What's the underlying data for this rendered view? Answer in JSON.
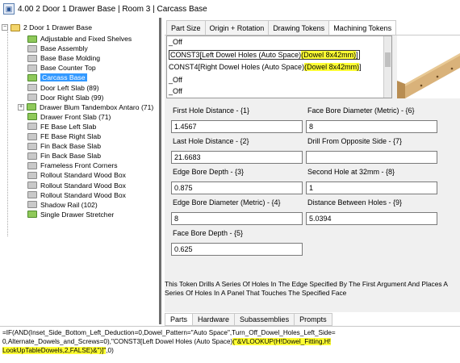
{
  "window": {
    "title": "4.00 2 Door 1 Drawer Base | Room 3 | Carcass Base"
  },
  "tree": {
    "root": "2 Door 1 Drawer Base",
    "items": [
      {
        "label": "Adjustable and Fixed Shelves",
        "color": "green",
        "expand": false
      },
      {
        "label": "Base Assembly",
        "color": "gray",
        "expand": false
      },
      {
        "label": "Base Base Molding",
        "color": "gray",
        "expand": false
      },
      {
        "label": "Base Counter Top",
        "color": "gray",
        "expand": false
      },
      {
        "label": "Carcass Base",
        "color": "green",
        "expand": false,
        "selected": true
      },
      {
        "label": "Door Left Slab (89)",
        "color": "gray",
        "expand": false
      },
      {
        "label": "Door Right Slab (99)",
        "color": "gray",
        "expand": false
      },
      {
        "label": "Drawer Blum Tandembox Antaro (71)",
        "color": "green",
        "expand": true
      },
      {
        "label": "Drawer Front Slab (71)",
        "color": "green",
        "expand": false
      },
      {
        "label": "FE Base Left Slab",
        "color": "gray",
        "expand": false
      },
      {
        "label": "FE Base Right Slab",
        "color": "gray",
        "expand": false
      },
      {
        "label": "Fin Back Base Slab",
        "color": "gray",
        "expand": false
      },
      {
        "label": "Fin Back Base Slab",
        "color": "gray",
        "expand": false
      },
      {
        "label": "Frameless Front Corners",
        "color": "gray",
        "expand": false
      },
      {
        "label": "Rollout Standard Wood Box",
        "color": "gray",
        "expand": false
      },
      {
        "label": "Rollout Standard Wood Box",
        "color": "gray",
        "expand": false
      },
      {
        "label": "Rollout Standard Wood Box",
        "color": "gray",
        "expand": false
      },
      {
        "label": "Shadow Rail (102)",
        "color": "gray",
        "expand": false
      },
      {
        "label": "Single Drawer Stretcher",
        "color": "green",
        "expand": false
      }
    ]
  },
  "tabs": [
    "Part Size",
    "Origin + Rotation",
    "Drawing Tokens",
    "Machining Tokens"
  ],
  "active_tab": "Machining Tokens",
  "tokens": {
    "t0": "_Off",
    "t1_pre": "CONST3[Left Dowel Holes (Auto Space)",
    "t1_hl": "(Dowel 8x42mm)",
    "t1_post": "]",
    "t2_pre": "CONST4[Right Dowel Holes (Auto Space)",
    "t2_hl": "(Dowel 8x42mm)",
    "t2_post": "]",
    "t3": "_Off",
    "t4": "_Off"
  },
  "fields": {
    "f1": {
      "label": "First Hole Distance - {1}",
      "value": "1.4567"
    },
    "f2": {
      "label": "Last Hole Distance - {2}",
      "value": "21.6683"
    },
    "f3": {
      "label": "Edge Bore Depth - {3}",
      "value": "0.875"
    },
    "f4": {
      "label": "Edge Bore Diameter (Metric) - {4}",
      "value": "8"
    },
    "f5": {
      "label": "Face Bore Depth - {5}",
      "value": "0.625"
    },
    "f6": {
      "label": "Face Bore Diameter (Metric) - {6}",
      "value": "8"
    },
    "f7": {
      "label": "Drill From Opposite Side - {7}",
      "value": ""
    },
    "f8": {
      "label": "Second Hole at 32mm - {8}",
      "value": "1"
    },
    "f9": {
      "label": "Distance Between Holes - {9}",
      "value": "5.0394"
    }
  },
  "description": "This Token Drills A Series Of Holes In The Edge Specified By The First Argument And Places A Series Of Holes In A Panel That Touches The Specified Face",
  "bottom_tabs": [
    "Parts",
    "Hardware",
    "Subassemblies",
    "Prompts"
  ],
  "formula": {
    "line1": "=IF(AND(Inset_Side_Bottom_Left_Deduction=0,Dowel_Pattern=\"Auto Space\",Turn_Off_Dowel_Holes_Left_Side=",
    "line2_pre": "0,Alternate_Dowels_and_Screws=0),\"CONST3[Left Dowel Holes (Auto Space)",
    "line2_hl": "(\"&VLOOKUP(H!Dowel_Fitting,H!",
    "line3_hl": "LookUpTableDowels,2,FALSE)&\")]\"",
    "line3_post": ",0)"
  },
  "colors": {
    "highlight": "#ffff33",
    "selection": "#3399ff",
    "folder_green": "#8fc95a"
  }
}
